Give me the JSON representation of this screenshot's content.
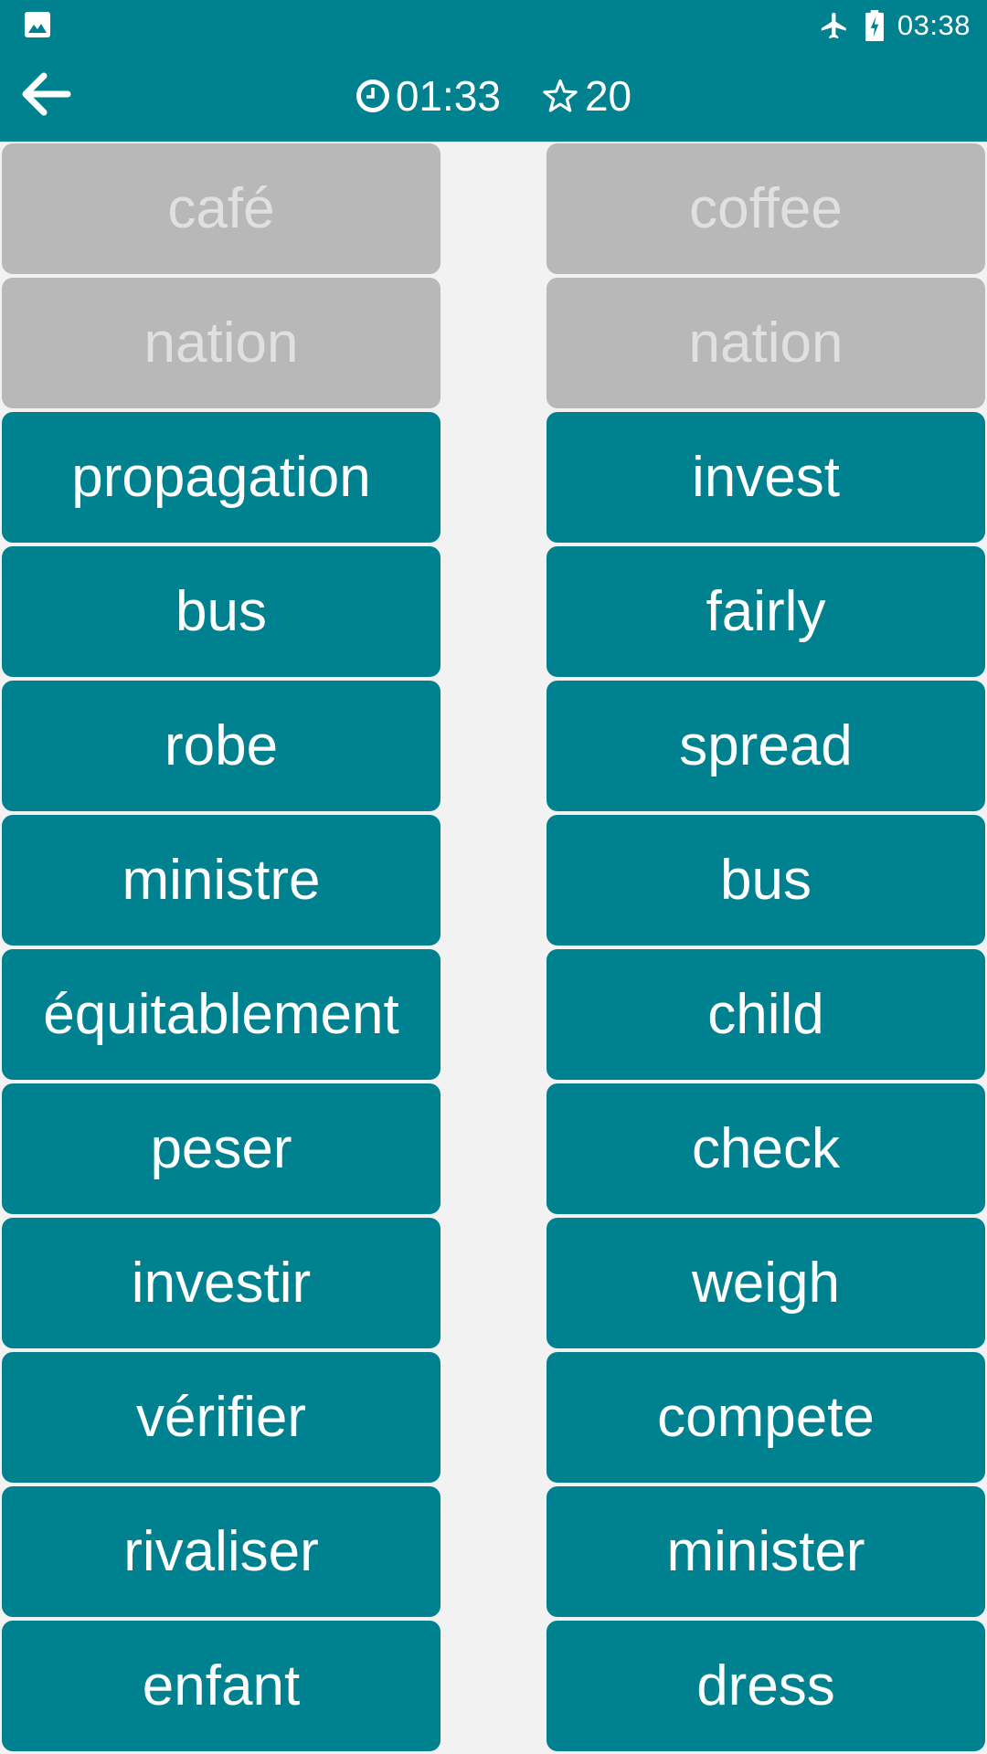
{
  "status_bar": {
    "left_icon": "image-icon",
    "icons": [
      "airplane-mode-icon",
      "battery-charging-icon"
    ],
    "time": "03:38"
  },
  "toolbar": {
    "back_icon": "arrow-left-icon",
    "timer_icon": "clock-icon",
    "timer": "01:33",
    "score_icon": "star-outline-icon",
    "score": "20"
  },
  "colors": {
    "primary": "#00818F",
    "background": "#F2F2F2",
    "matched_card": "#B8B8B8",
    "matched_text": "#E0E0E0",
    "text_on_primary": "#FFFFFF"
  },
  "board": {
    "left_column_language": "French",
    "right_column_language": "English",
    "left": [
      {
        "word": "café",
        "matched": true
      },
      {
        "word": "nation",
        "matched": true
      },
      {
        "word": "propagation",
        "matched": false
      },
      {
        "word": "bus",
        "matched": false
      },
      {
        "word": "robe",
        "matched": false
      },
      {
        "word": "ministre",
        "matched": false
      },
      {
        "word": "équitablement",
        "matched": false
      },
      {
        "word": "peser",
        "matched": false
      },
      {
        "word": "investir",
        "matched": false
      },
      {
        "word": "vérifier",
        "matched": false
      },
      {
        "word": "rivaliser",
        "matched": false
      },
      {
        "word": "enfant",
        "matched": false
      }
    ],
    "right": [
      {
        "word": "coffee",
        "matched": true
      },
      {
        "word": "nation",
        "matched": true
      },
      {
        "word": "invest",
        "matched": false
      },
      {
        "word": "fairly",
        "matched": false
      },
      {
        "word": "spread",
        "matched": false
      },
      {
        "word": "bus",
        "matched": false
      },
      {
        "word": "child",
        "matched": false
      },
      {
        "word": "check",
        "matched": false
      },
      {
        "word": "weigh",
        "matched": false
      },
      {
        "word": "compete",
        "matched": false
      },
      {
        "word": "minister",
        "matched": false
      },
      {
        "word": "dress",
        "matched": false
      }
    ]
  }
}
